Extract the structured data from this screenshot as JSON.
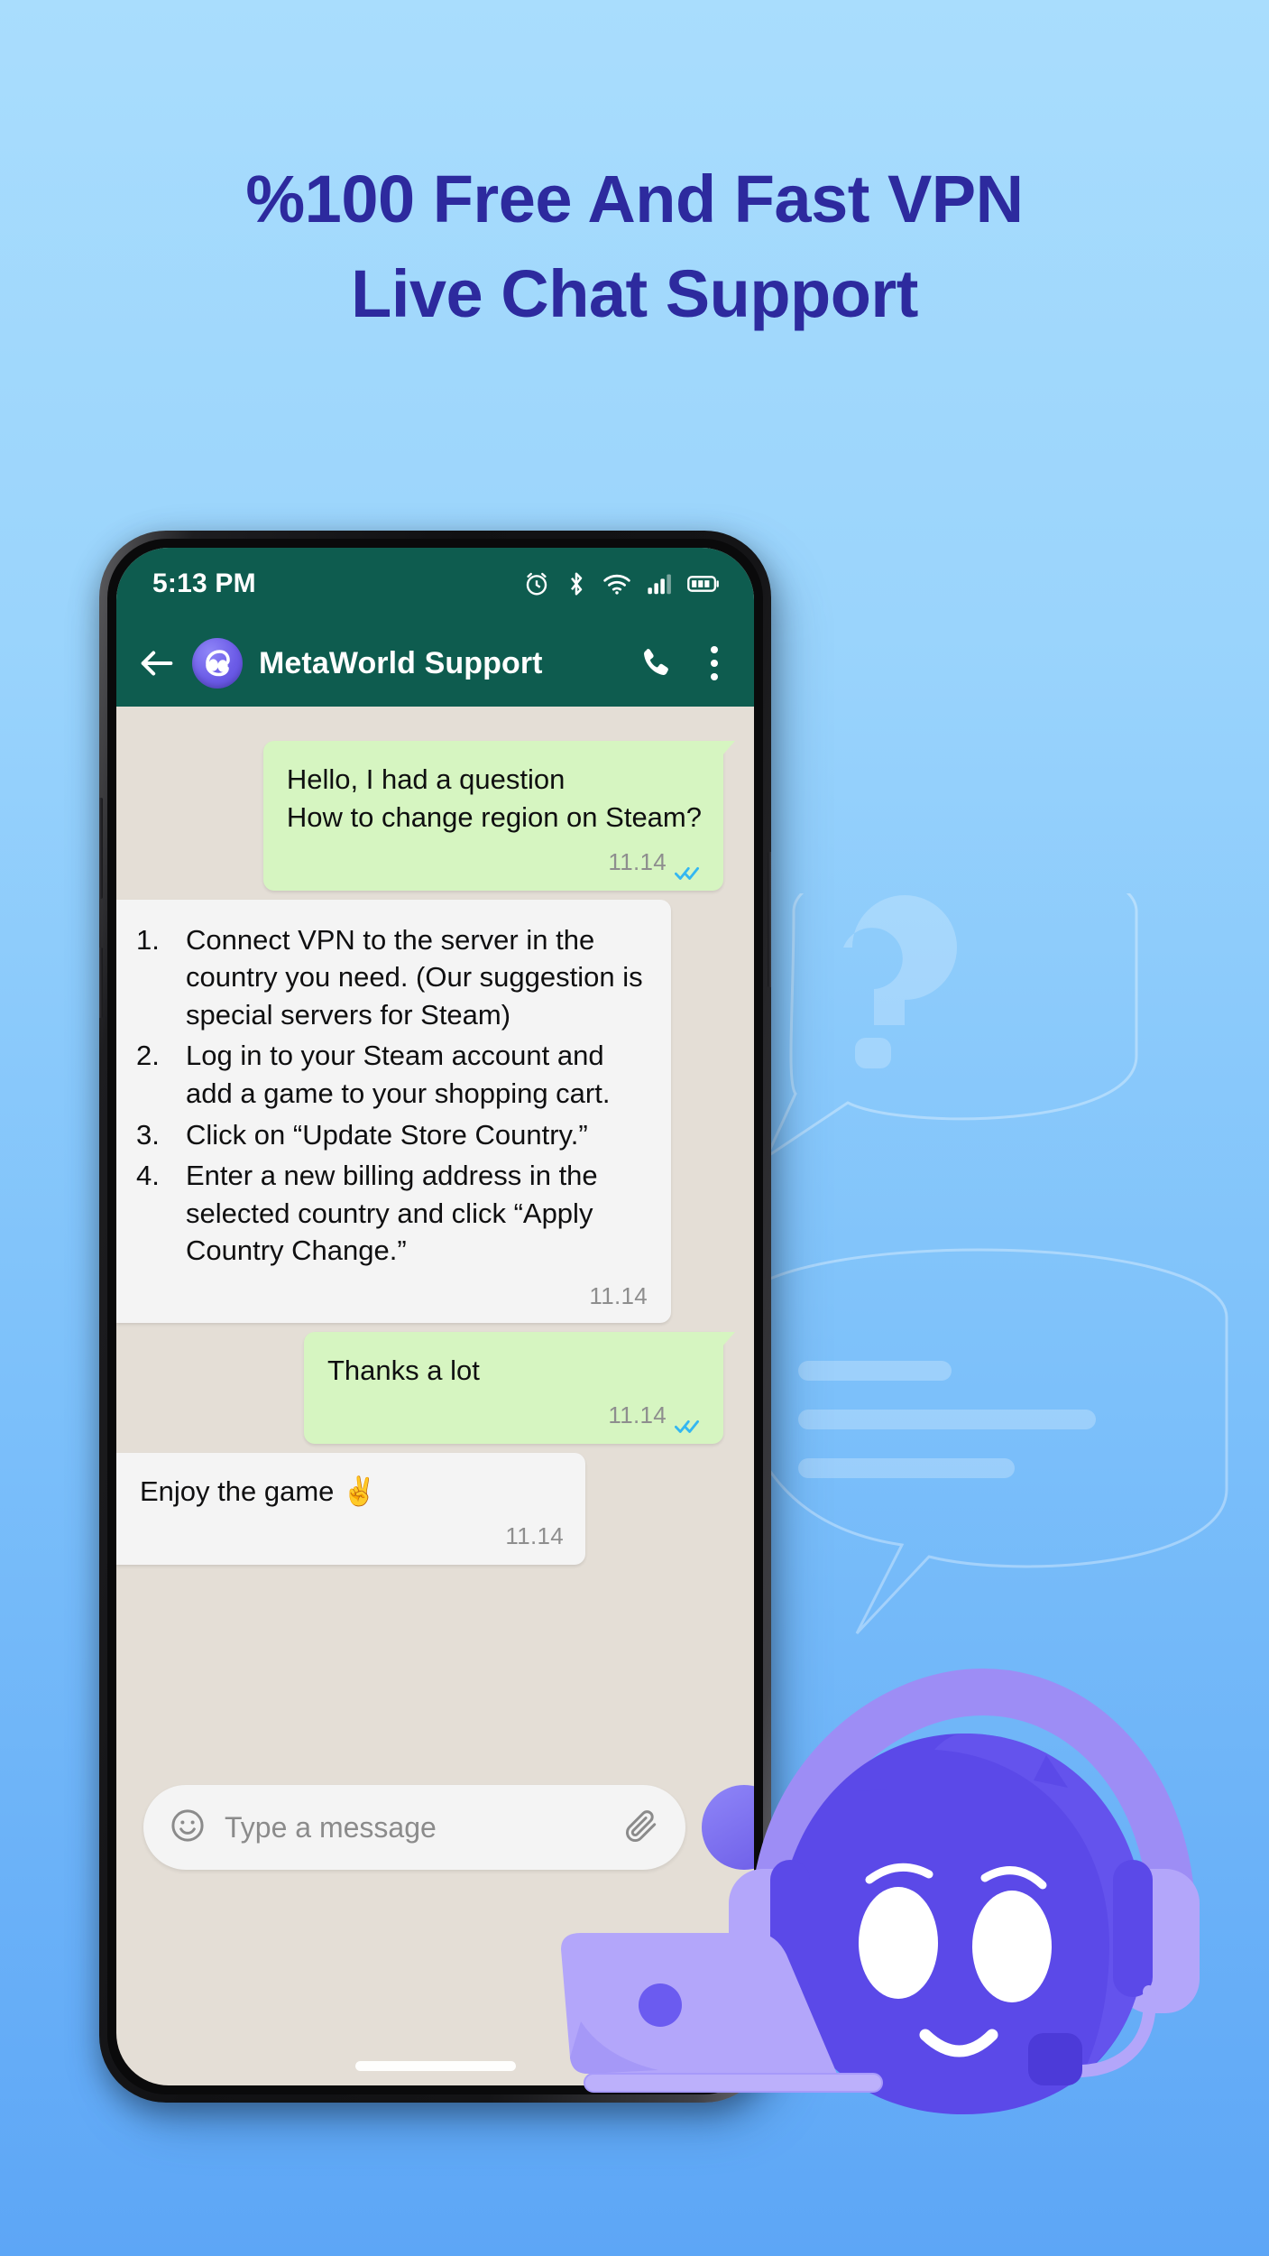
{
  "headline": {
    "line1": "%100 Free And Fast VPN",
    "line2": "Live Chat Support",
    "color": "#2d2a9e"
  },
  "theme": {
    "background_top": "#a9ddfd",
    "background_bottom": "#5da6f6",
    "whatsapp_header": "#0e5c4f",
    "chat_background": "#e4ded6",
    "outgoing_bubble": "#d6f5c1",
    "incoming_bubble": "#f4f4f4",
    "accent_purple": "#6c5ce7",
    "tick_blue": "#34b7f1"
  },
  "phone": {
    "status_bar": {
      "time": "5:13 PM",
      "icons": [
        "alarm-icon",
        "bluetooth-icon",
        "wifi-icon",
        "signal-icon",
        "battery-icon"
      ]
    },
    "chat_header": {
      "back_icon": "back-arrow-icon",
      "avatar": "mascot-avatar",
      "title": "MetaWorld Support",
      "call_icon": "phone-call-icon",
      "menu_icon": "overflow-menu-icon"
    },
    "messages": [
      {
        "direction": "out",
        "lines": [
          "Hello, I had a question",
          "How to change region on Steam?"
        ],
        "time": "11.14",
        "status": "read"
      },
      {
        "direction": "in",
        "type": "numbered-list",
        "steps": [
          {
            "num": "1.",
            "text": "Connect VPN to the server in the country you need. (Our suggestion is special servers for Steam)"
          },
          {
            "num": "2.",
            "text": "Log in to your Steam account and add a game to your shopping cart."
          },
          {
            "num": "3.",
            "text": "Click on “Update Store Country.”"
          },
          {
            "num": "4.",
            "text": "Enter a new billing address in the selected country and click “Apply Country Change.”"
          }
        ],
        "time": "11.14",
        "status": "none"
      },
      {
        "direction": "out",
        "lines": [
          "Thanks a lot"
        ],
        "time": "11.14",
        "status": "read"
      },
      {
        "direction": "in",
        "lines": [
          "Enjoy the game ✌️"
        ],
        "time": "11.14",
        "status": "none"
      }
    ],
    "composer": {
      "emoji_icon": "emoji-smiley-icon",
      "placeholder": "Type a message",
      "attach_icon": "paperclip-icon",
      "send_icon": "send-icon"
    }
  },
  "decor": {
    "mascot": "support-robot-mascot-with-headset",
    "laptop": "laptop-illustration",
    "watermark": [
      "question-mark-speech-bubble",
      "text-lines-speech-bubble"
    ]
  }
}
